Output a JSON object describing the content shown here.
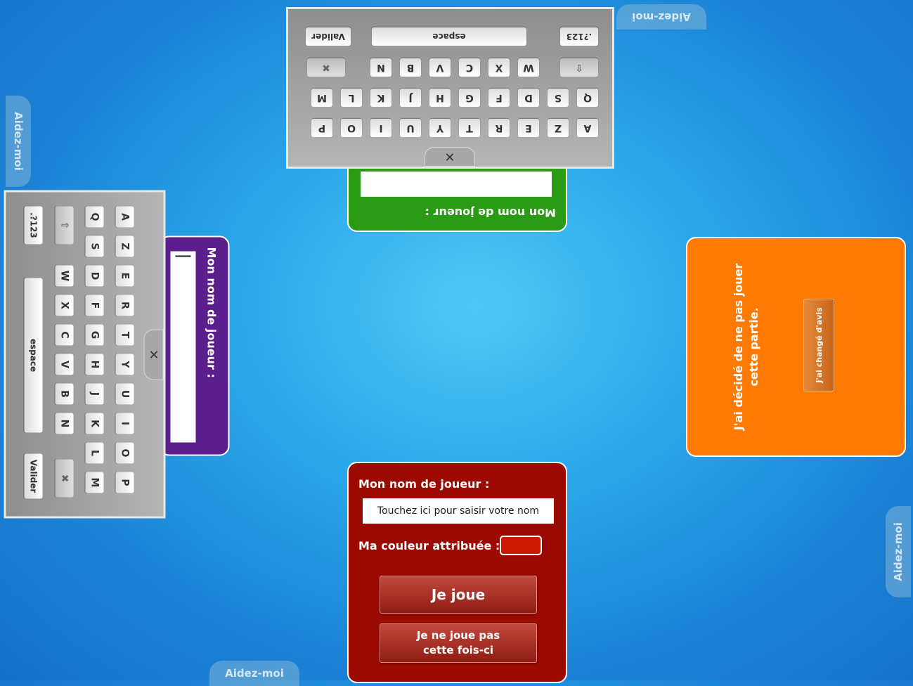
{
  "help_label": "Aidez-moi",
  "bottom_player": {
    "name_label": "Mon nom de joueur :",
    "name_placeholder": "Touchez ici pour saisir votre nom",
    "color_label": "Ma couleur attribuée :",
    "assigned_color": "#cc1a00",
    "play_button": "Je joue",
    "skip_button_line1": "Je ne joue pas",
    "skip_button_line2": "cette fois-ci"
  },
  "top_player": {
    "name_label": "Mon nom de joueur :"
  },
  "left_player": {
    "name_label": "Mon nom de joueur :"
  },
  "right_player": {
    "declined_line1": "J'ai décidé de ne pas jouer",
    "declined_line2": "cette partie.",
    "changed_mind_button": "J'ai changé d'avis"
  },
  "keyboard": {
    "row1": [
      "A",
      "Z",
      "E",
      "R",
      "T",
      "Y",
      "U",
      "I",
      "O",
      "P"
    ],
    "row2": [
      "Q",
      "S",
      "D",
      "F",
      "G",
      "H",
      "J",
      "K",
      "L",
      "M"
    ],
    "row3": [
      "W",
      "X",
      "C",
      "V",
      "B",
      "N"
    ],
    "numbers_key": ".?123",
    "space_key": "espace",
    "validate_key": "Valider",
    "close_symbol": "✕",
    "shift_symbol": "⇧",
    "backspace_symbol": "✖"
  }
}
